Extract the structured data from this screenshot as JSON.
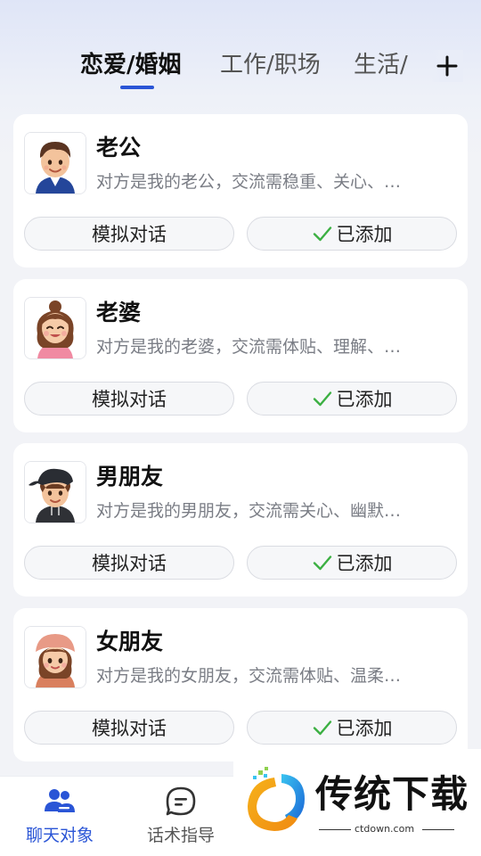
{
  "tabs": {
    "items": [
      "恋爱/婚姻",
      "工作/职场",
      "生活/"
    ],
    "active_index": 0,
    "add_icon": "plus-icon"
  },
  "cards": [
    {
      "name": "老公",
      "description": "对方是我的老公，交流需稳重、关心、…",
      "avatar_icon": "husband-avatar-icon",
      "chat_label": "模拟对话",
      "added_label": "已添加"
    },
    {
      "name": "老婆",
      "description": "对方是我的老婆，交流需体贴、理解、…",
      "avatar_icon": "wife-avatar-icon",
      "chat_label": "模拟对话",
      "added_label": "已添加"
    },
    {
      "name": "男朋友",
      "description": "对方是我的男朋友，交流需关心、幽默…",
      "avatar_icon": "boyfriend-avatar-icon",
      "chat_label": "模拟对话",
      "added_label": "已添加"
    },
    {
      "name": "女朋友",
      "description": "对方是我的女朋友，交流需体贴、温柔…",
      "avatar_icon": "girlfriend-avatar-icon",
      "chat_label": "模拟对话",
      "added_label": "已添加"
    }
  ],
  "bottom_nav": {
    "items": [
      {
        "label": "聊天对象",
        "icon": "people-icon",
        "active": true
      },
      {
        "label": "话术指导",
        "icon": "chat-bubble-icon",
        "active": false
      }
    ]
  },
  "watermark": {
    "text": "传统下载",
    "sub": "ctdown.com"
  },
  "colors": {
    "accent": "#2a55d6",
    "check": "#3cb043",
    "text_primary": "#111111",
    "text_secondary": "#7a7d85",
    "background": "#f2f3f7"
  }
}
